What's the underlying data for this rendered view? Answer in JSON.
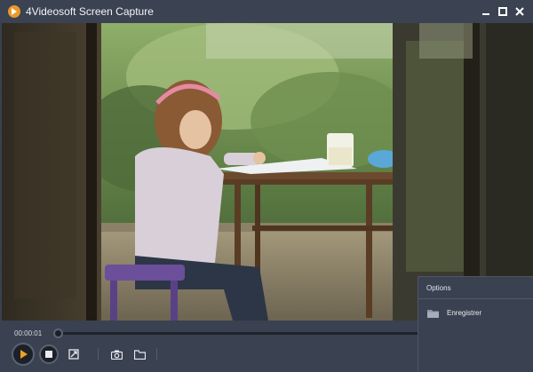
{
  "window": {
    "title": "4Videosoft Screen Capture",
    "controls": [
      "minimize",
      "maximize",
      "close"
    ]
  },
  "player": {
    "current_time": "00:00:01",
    "progress": 0.0
  },
  "toolbar": {
    "buttons": [
      {
        "name": "play",
        "icon": "play-icon",
        "color": "#f0a020"
      },
      {
        "name": "stop",
        "icon": "stop-icon"
      },
      {
        "name": "edit",
        "icon": "edit-icon"
      },
      {
        "name": "snapshot",
        "icon": "camera-icon"
      },
      {
        "name": "open-folder",
        "icon": "folder-icon"
      }
    ]
  },
  "options_menu": {
    "title": "Options",
    "items": [
      {
        "label": "Enregistrer",
        "icon": "folder-icon"
      }
    ]
  },
  "colors": {
    "window_bg": "#3a4150",
    "accent": "#f0a020"
  }
}
